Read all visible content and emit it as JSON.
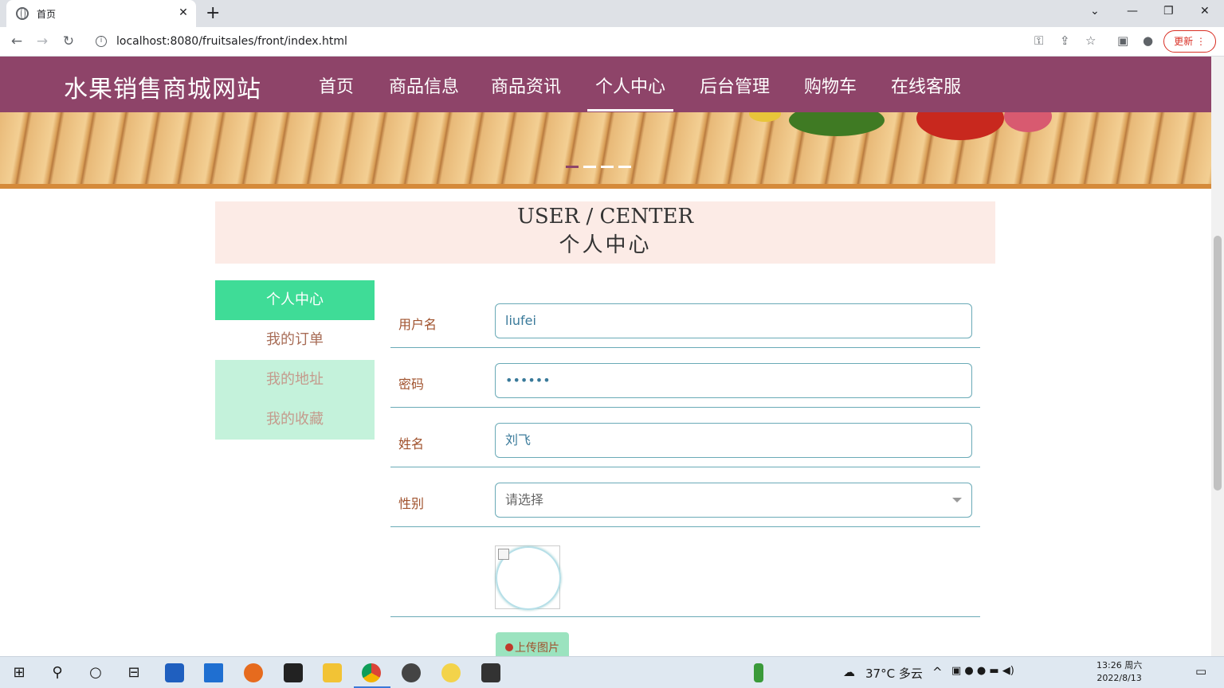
{
  "browser": {
    "tab_title": "首页",
    "url": "localhost:8080/fruitsales/front/index.html",
    "update_label": "更新"
  },
  "site": {
    "brand": "水果销售商城网站",
    "menu": [
      {
        "label": "首页",
        "active": false
      },
      {
        "label": "商品信息",
        "active": false
      },
      {
        "label": "商品资讯",
        "active": false
      },
      {
        "label": "个人中心",
        "active": true
      },
      {
        "label": "后台管理",
        "active": false
      },
      {
        "label": "购物车",
        "active": false
      },
      {
        "label": "在线客服",
        "active": false
      }
    ]
  },
  "center": {
    "title_en": "USER / CENTER",
    "title_cn": "个人中心"
  },
  "sidebar": {
    "items": [
      {
        "label": "个人中心",
        "state": "active"
      },
      {
        "label": "我的订单",
        "state": "normal"
      },
      {
        "label": "我的地址",
        "state": "soft"
      },
      {
        "label": "我的收藏",
        "state": "soft"
      }
    ]
  },
  "form": {
    "username": {
      "label": "用户名",
      "value": "liufei"
    },
    "password": {
      "label": "密码",
      "value": "••••••"
    },
    "name": {
      "label": "姓名",
      "value": "刘飞"
    },
    "gender": {
      "label": "性别",
      "placeholder": "请选择"
    },
    "upload_label": "上传图片"
  },
  "taskbar": {
    "weather": "37°C  多云",
    "time": "13:26 周六",
    "date": "2022/8/13"
  },
  "colors": {
    "nav_bg": "#8e4469",
    "active_green": "#3fdc97",
    "soft_green": "#c4f2db",
    "banner_pink": "#fcebe6",
    "input_border": "#6aaab7"
  }
}
